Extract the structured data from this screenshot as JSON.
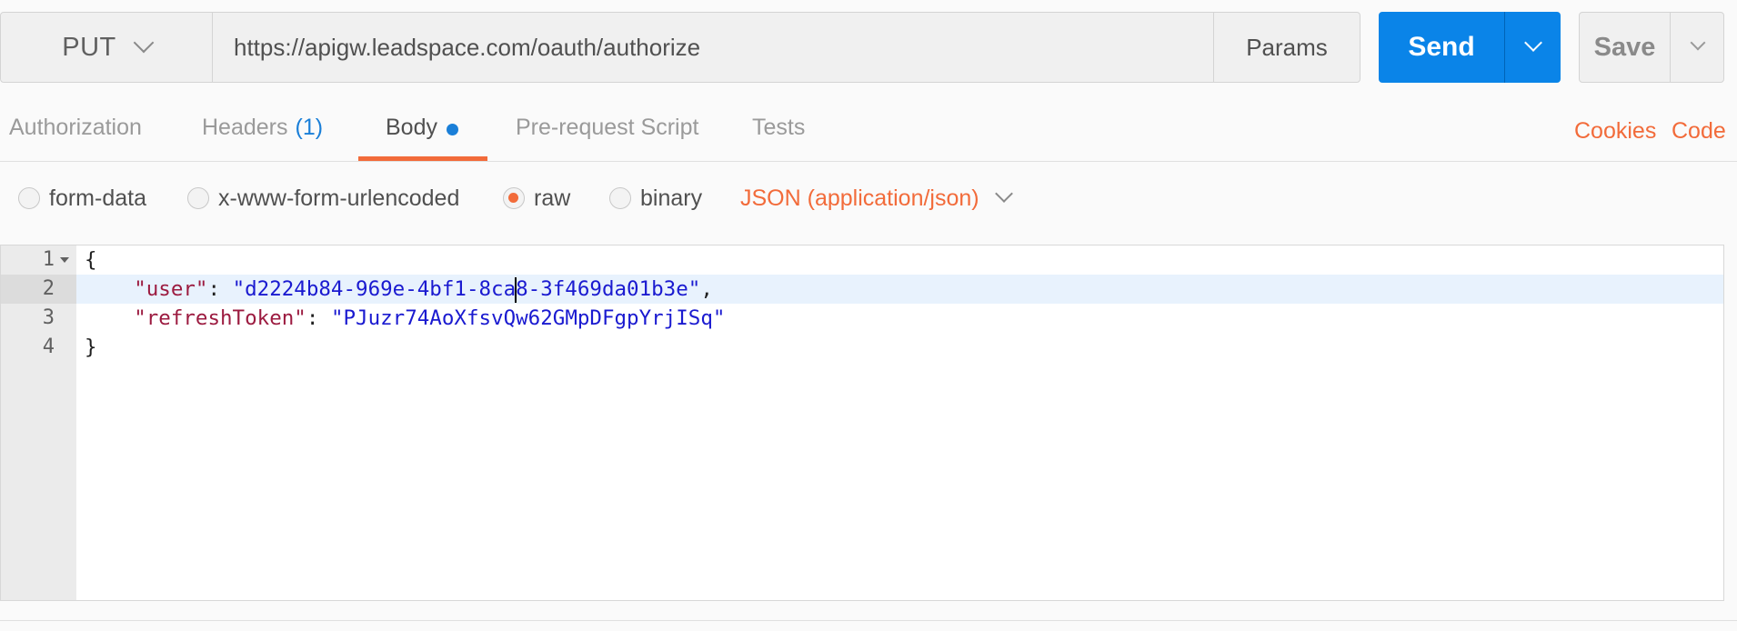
{
  "request": {
    "method": "PUT",
    "url": "https://apigw.leadspace.com/oauth/authorize",
    "params_label": "Params",
    "send_label": "Send",
    "save_label": "Save"
  },
  "tabs": {
    "authorization": "Authorization",
    "headers": "Headers",
    "headers_count": "(1)",
    "body": "Body",
    "prerequest": "Pre-request Script",
    "tests": "Tests",
    "cookies": "Cookies",
    "code": "Code"
  },
  "body_types": {
    "form_data": "form-data",
    "urlencoded": "x-www-form-urlencoded",
    "raw": "raw",
    "binary": "binary",
    "selected": "raw",
    "content_type": "JSON (application/json)"
  },
  "editor": {
    "line_numbers": [
      "1",
      "2",
      "3",
      "4"
    ],
    "active_line": 2,
    "open_brace": "{",
    "close_brace": "}",
    "user_key": "\"user\"",
    "user_value_before_cursor": "\"d2224b84-969e-4bf1-8ca",
    "user_value_after_cursor": "8-3f469da01b3e\"",
    "refresh_key": "\"refreshToken\"",
    "refresh_value": "\"PJuzr74AoXfsvQw62GMpDFgpYrjISq\"",
    "colon": ": ",
    "comma": ",",
    "indent": "    "
  },
  "colors": {
    "accent_orange": "#f26b3a",
    "send_blue": "#0a84e8",
    "json_key": "#9c1b40",
    "json_string": "#1a1ad0"
  },
  "icons": [
    "chevron-down-icon",
    "unsaved-dot-icon",
    "fold-arrow-icon"
  ]
}
